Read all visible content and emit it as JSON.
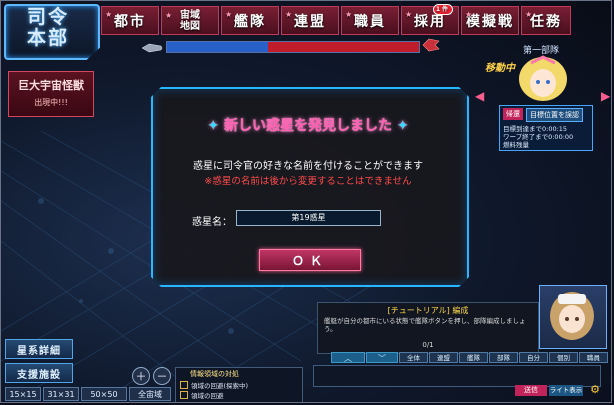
{
  "logo": "司令\n本部",
  "menu": [
    {
      "label": "都市",
      "w": 58
    },
    {
      "label": "宙域\n地図",
      "w": 58,
      "two": true
    },
    {
      "label": "艦隊",
      "w": 58
    },
    {
      "label": "連盟",
      "w": 58
    },
    {
      "label": "職員",
      "w": 58
    },
    {
      "label": "採用",
      "w": 58,
      "badge": "1件"
    },
    {
      "label": "模擬戦",
      "w": 58
    },
    {
      "label": "任務",
      "w": 50
    }
  ],
  "boss": {
    "title": "巨大宇宙怪獣",
    "sub": "出現中!!!"
  },
  "right_panel": {
    "team": "第一部隊",
    "status": "移動中",
    "chip_left": "帰還",
    "chip_right": "目標位置を誤認",
    "line1": "目標到達まで0:00:15",
    "line2": "ワープ終了まで0:00:00",
    "line3": "燃料残量"
  },
  "dialog": {
    "title": "新しい惑星を発見しました",
    "line1": "惑星に司令官の好きな名前を付けることができます",
    "line2": "※惑星の名前は後から変更することはできません",
    "planet_label": "惑星名：",
    "planet_value": "第19惑星",
    "ok": "ＯＫ"
  },
  "tutorial": {
    "title": "[チュートリアル] 編成",
    "body": "艦艇が自分の都市にいる状態で艦隊ボタンを押し、部隊編成しましょう。",
    "count": "0/1"
  },
  "chat_tabs": [
    "全体",
    "連盟",
    "艦隊",
    "部隊",
    "自分",
    "個別",
    "職員"
  ],
  "nav": {
    "up": "︿",
    "down": "﹀"
  },
  "chat": {
    "send": "送信",
    "light": "ライト表示"
  },
  "left": {
    "system_detail": "星系詳細",
    "support": "支援施設",
    "zoom_in": "＋",
    "zoom_out": "－",
    "scales": [
      "15×15",
      "31×31",
      "50×50",
      "全宙域"
    ]
  },
  "legend": {
    "title": "情報領域の対処",
    "row1": "領域の回避(探索中)",
    "row2": "領域の回避"
  }
}
